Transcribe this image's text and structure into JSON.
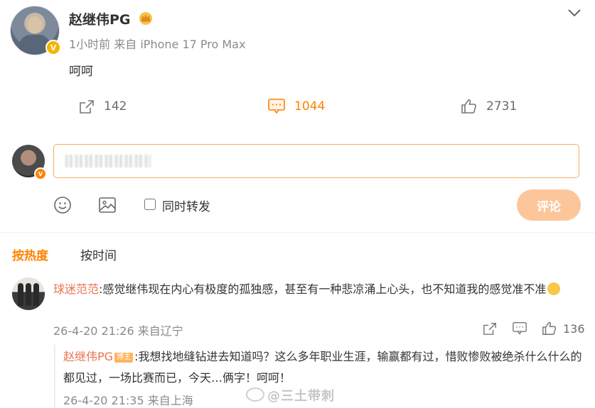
{
  "post": {
    "author": "赵继伟PG",
    "meta": "1小时前  来自 iPhone 17 Pro Max",
    "text": "呵呵",
    "badge_icon": "crown-icon",
    "verify_mark": "V"
  },
  "actions": {
    "share_count": "142",
    "comment_count": "1044",
    "like_count": "2731"
  },
  "composer": {
    "verify_mark": "V",
    "input_value": "",
    "repost_label": "同时转发",
    "submit_label": "评论"
  },
  "sort_tabs": {
    "hot": "按热度",
    "time": "按时间"
  },
  "comment": {
    "user": "球迷范范",
    "text": ":感觉继伟现在内心有极度的孤独感，甚至有一种悲凉涌上心头，也不知道我的感觉准不准",
    "meta": "26-4-20 21:26 来自辽宁",
    "like_count": "136"
  },
  "reply": {
    "user": "赵继伟PG",
    "badge": "博主",
    "text": ":我想找地缝钻进去知道吗？这么多年职业生涯，输赢都有过，惜败惨败被绝杀什么什么的都见过，一场比赛而已，今天…俩字！呵呵！",
    "meta": "26-4-20 21:35 来自上海"
  },
  "watermark": "@三土带刺",
  "colors": {
    "accent": "#ff8200",
    "username_link": "#eb7350",
    "muted": "#8a8a8a",
    "submit_disabled": "#fdc69a"
  }
}
